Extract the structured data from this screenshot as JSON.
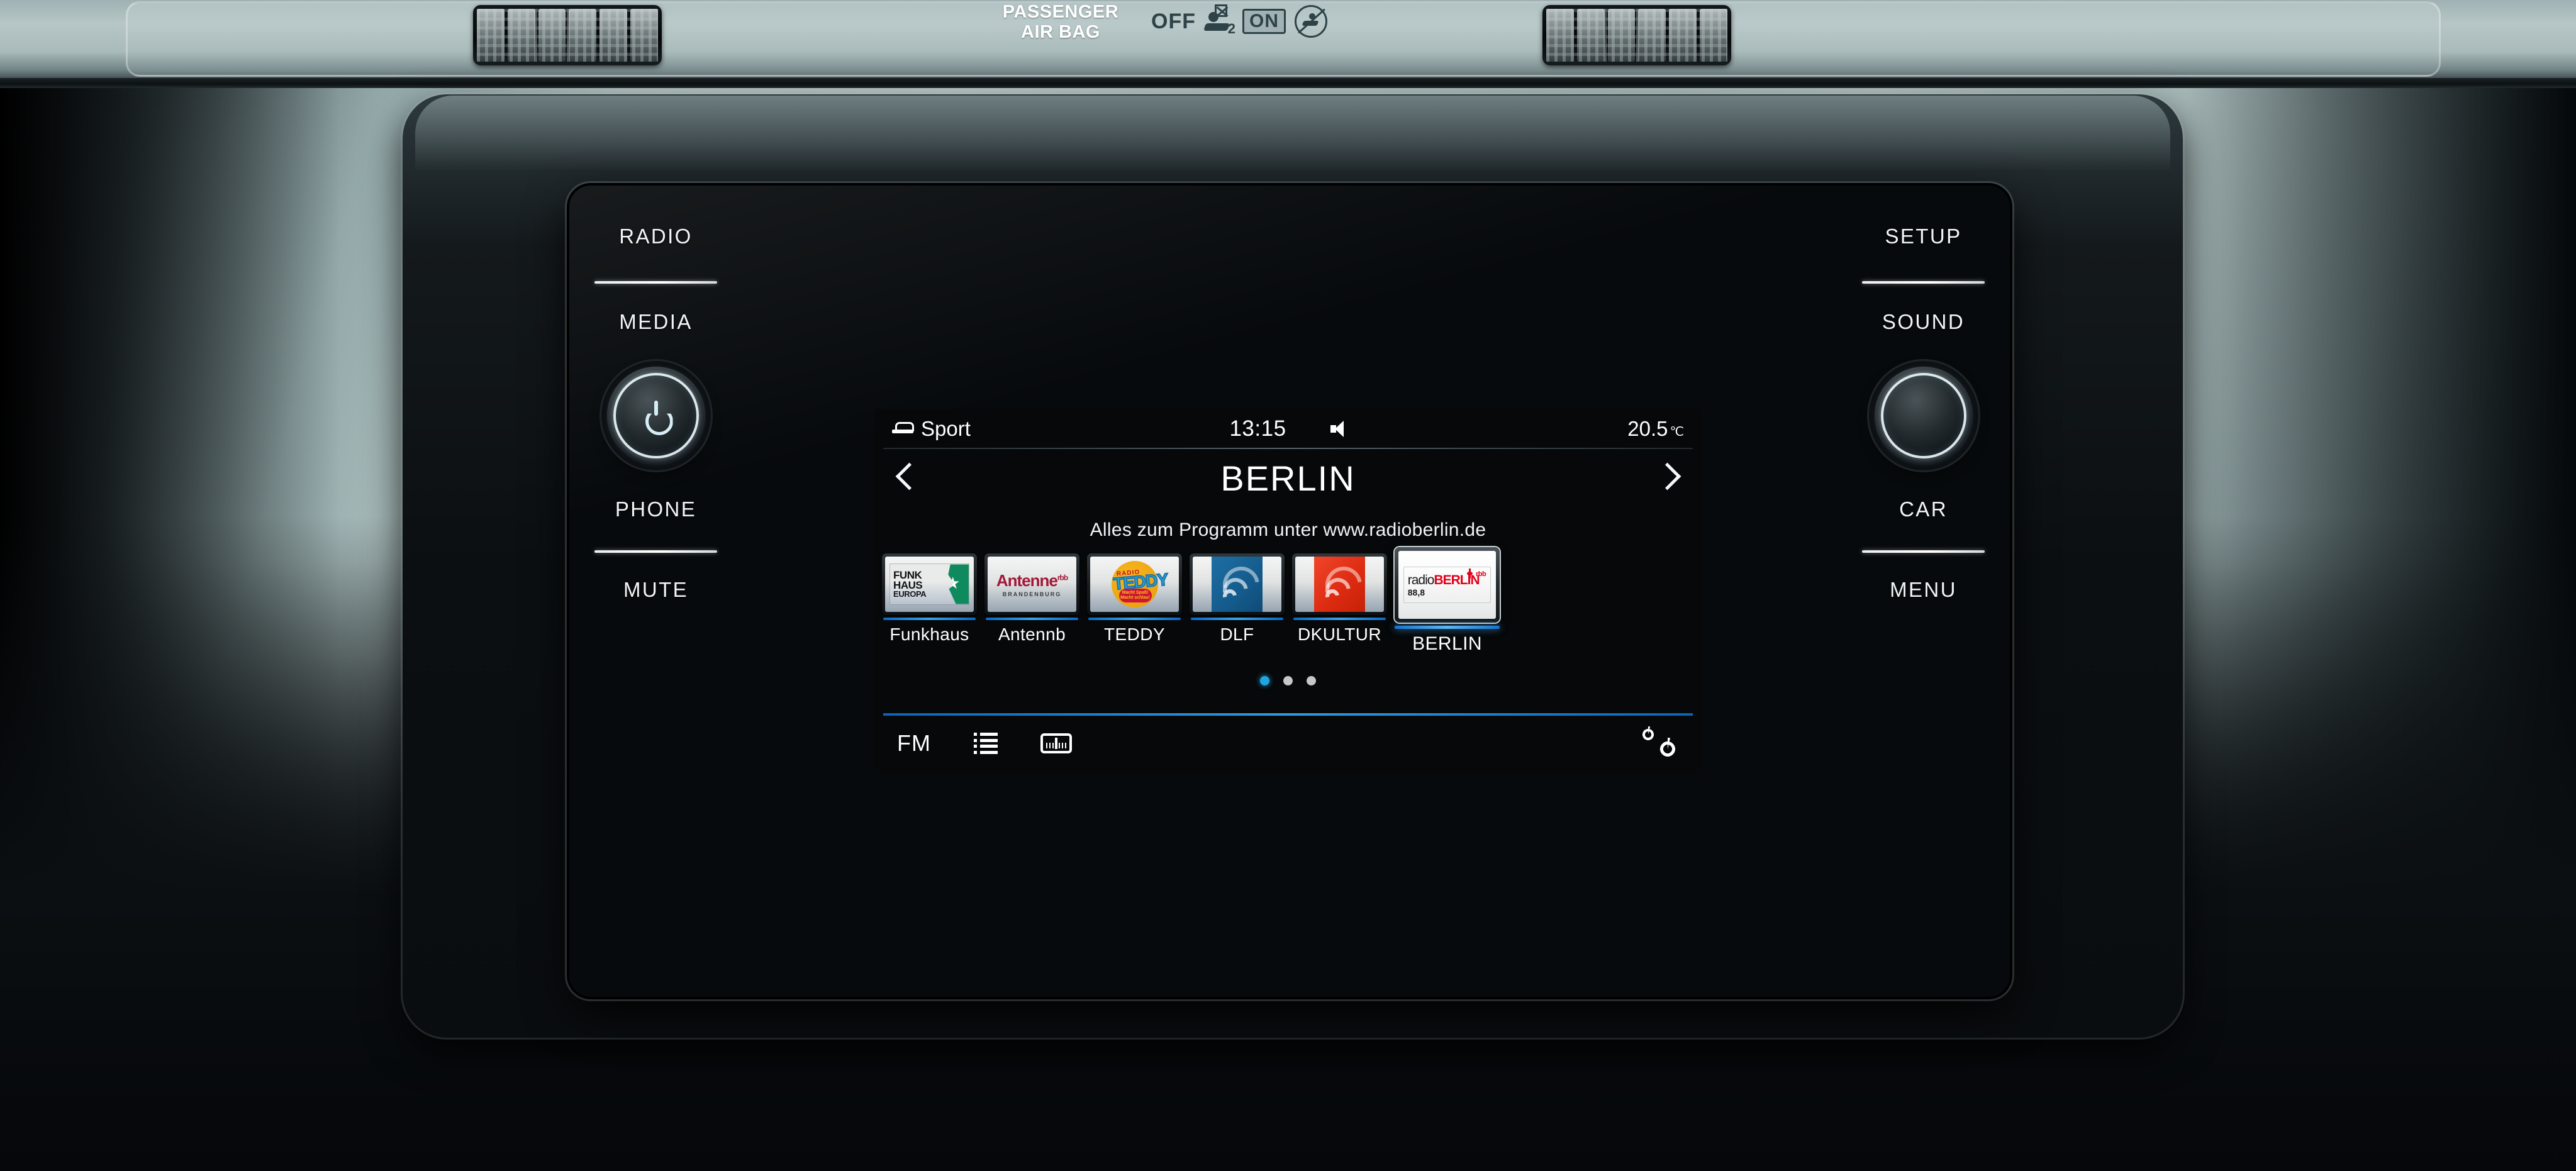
{
  "dashboard": {
    "airbag": {
      "label_line1": "PASSENGER",
      "label_line2": "AIR BAG",
      "off_label": "OFF",
      "on_label": "ON",
      "seat_sub": "2"
    }
  },
  "hardkeys": {
    "left": [
      {
        "label": "RADIO",
        "name": "radio-button"
      },
      {
        "label": "MEDIA",
        "name": "media-button"
      },
      {
        "label": "PHONE",
        "name": "phone-button"
      },
      {
        "label": "MUTE",
        "name": "mute-button"
      }
    ],
    "right": [
      {
        "label": "SETUP",
        "name": "setup-button"
      },
      {
        "label": "SOUND",
        "name": "sound-button"
      },
      {
        "label": "CAR",
        "name": "car-button"
      },
      {
        "label": "MENU",
        "name": "menu-button"
      }
    ]
  },
  "screen": {
    "status": {
      "drive_mode": "Sport",
      "drive_mode_icon": "car-icon",
      "time": "13:15",
      "audio_icon": "speaker-icon",
      "temperature": "20.5",
      "temperature_unit": "℃"
    },
    "nav": {
      "prev_icon": "chevron-left-icon",
      "next_icon": "chevron-right-icon"
    },
    "title": "BERLIN",
    "subtitle": "Alles zum Programm unter www.radioberlin.de",
    "presets": [
      {
        "label": "Funkhaus",
        "logo": "funkhaus-europa-logo",
        "logo_text": {
          "l1": "FUNK",
          "l2": "HAUS",
          "l3": "EUROPA"
        },
        "selected": false
      },
      {
        "label": "Antennb",
        "logo": "antenne-brandenburg-logo",
        "logo_text": {
          "main": "Antenne",
          "sup": "rbb",
          "sub": "BRANDENBURG"
        },
        "selected": false
      },
      {
        "label": "TEDDY",
        "logo": "radio-teddy-logo",
        "logo_text": {
          "top": "RADIO",
          "main": "TEDDY",
          "tag1": "Macht Spaß!",
          "tag2": "Macht schlau!"
        },
        "selected": false
      },
      {
        "label": "DLF",
        "logo": "deutschlandfunk-wave-logo",
        "selected": false
      },
      {
        "label": "DKULTUR",
        "logo": "deutschlandfunk-kultur-wave-logo",
        "selected": false
      },
      {
        "label": "BERLIN",
        "logo": "radio-berlin-rbb-logo",
        "logo_text": {
          "a": "radio",
          "b": "BERLIN",
          "rbb": "rbb",
          "freq": "88,8"
        },
        "selected": true
      }
    ],
    "pager": {
      "total": 3,
      "active_index": 0
    },
    "toolbar": {
      "band_label": "FM",
      "list_icon": "station-list-icon",
      "manualtune_icon": "frequency-band-icon",
      "settings_icon": "settings-gears-icon"
    }
  },
  "colors": {
    "accent_blue": "#2f9ae2",
    "accent_blue_dark": "#0a63b8",
    "dot_active": "#1fa5e0",
    "screen_bg": "#060809",
    "rbb_red": "#e2001a"
  }
}
